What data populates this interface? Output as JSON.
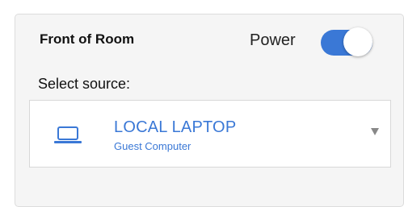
{
  "panel": {
    "title": "Front of Room",
    "power": {
      "label": "Power",
      "on": true
    },
    "select_label": "Select source:",
    "source": {
      "name": "LOCAL LAPTOP",
      "subtitle": "Guest Computer",
      "icon": "laptop-icon"
    }
  },
  "colors": {
    "accent": "#3a78d6",
    "panel_bg": "#f5f5f5",
    "border": "#dcdcdc"
  }
}
